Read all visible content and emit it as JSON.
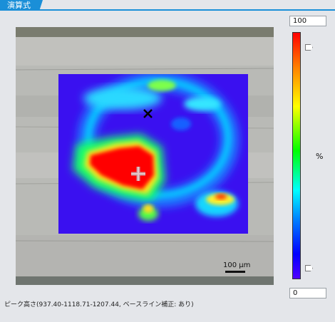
{
  "tab": {
    "label": "演算式"
  },
  "colorbar": {
    "max_value": "100",
    "min_value": "0",
    "unit": "%",
    "upper_handle_level": 1.0,
    "lower_handle_level": 0.0,
    "gradient": [
      "#ff0000",
      "#ff8000",
      "#ffff00",
      "#00ff00",
      "#00ffff",
      "#0080ff",
      "#0000ff",
      "#5000ff"
    ]
  },
  "image": {
    "scale_bar_label": "100 µm",
    "background_color": "#b8b8b4",
    "map_base_color": "#3a10f0"
  },
  "status": {
    "text": "ピーク高さ(937.40-1118.71-1207.44, ベースライン補正: あり)"
  }
}
